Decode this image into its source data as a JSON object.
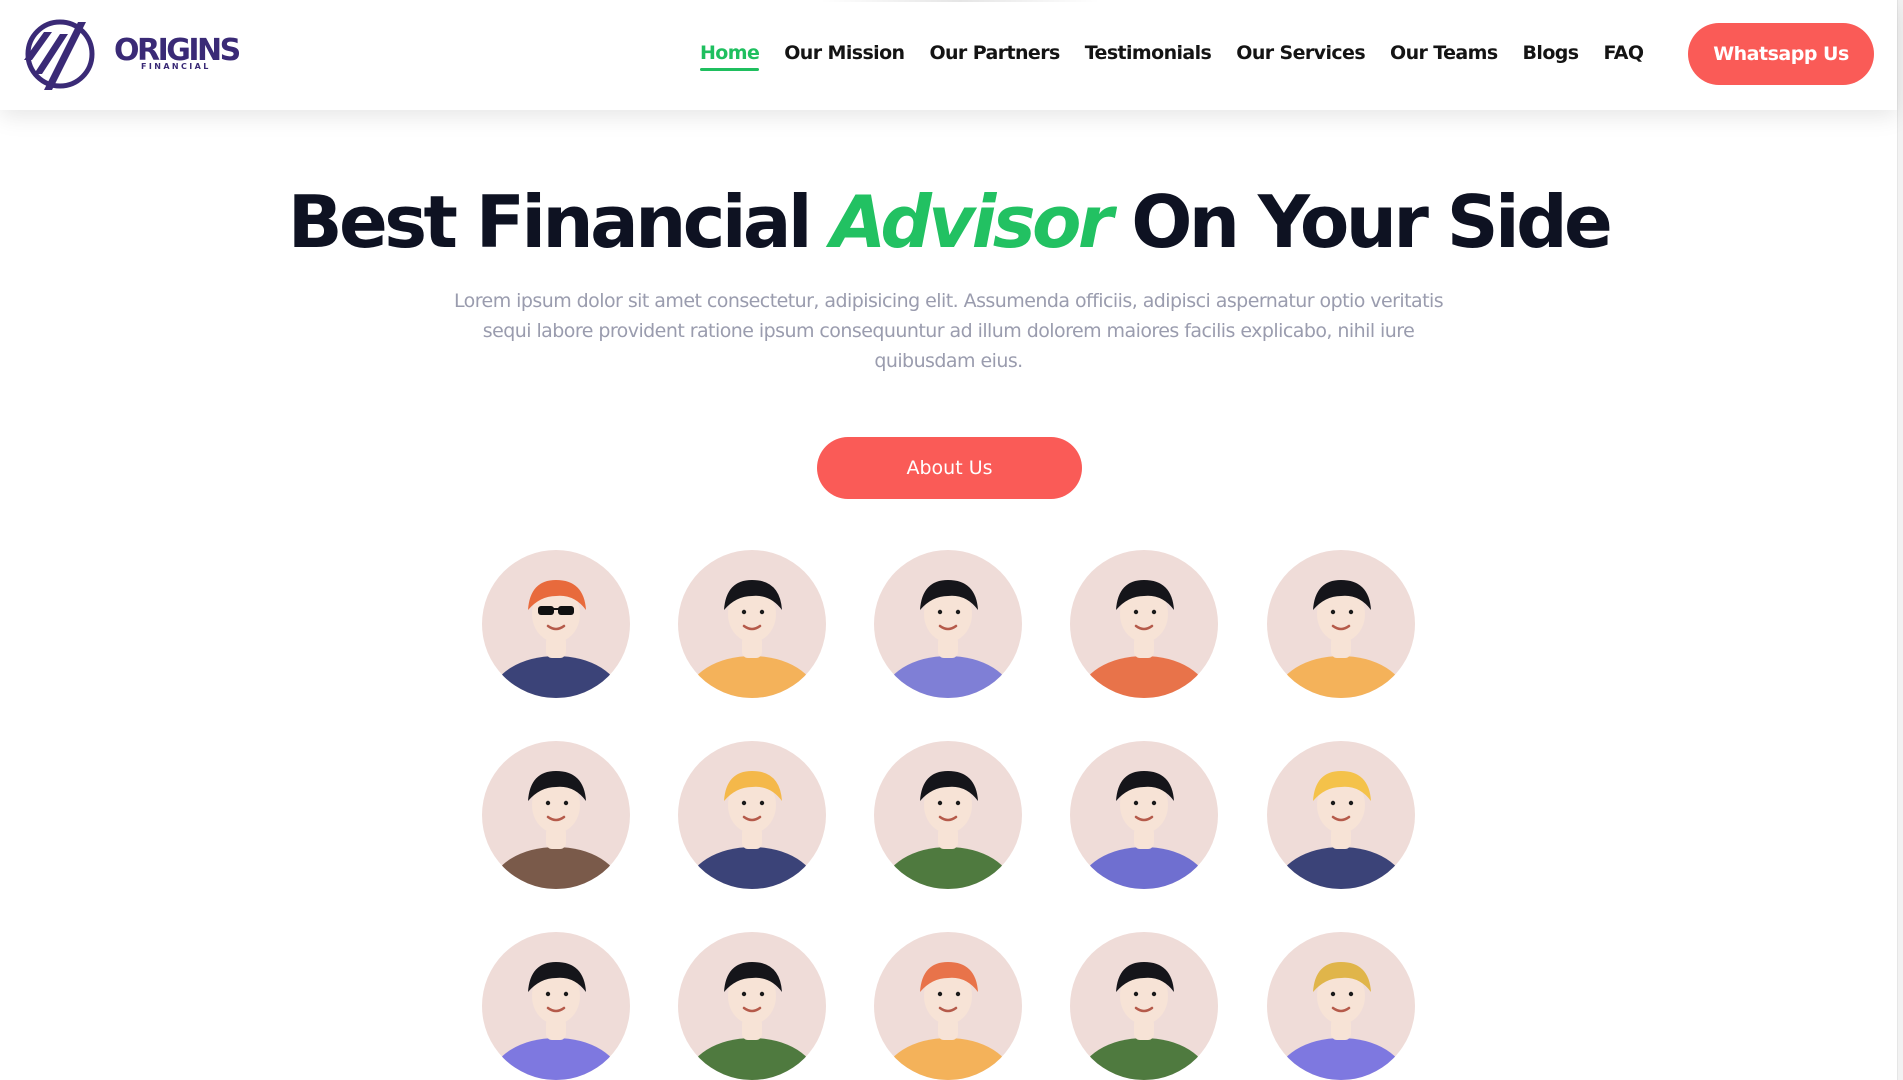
{
  "brand": {
    "name": "ORIGINS",
    "tagline": "FINANCIAL",
    "color": "#3a2a76"
  },
  "nav": {
    "links": [
      {
        "label": "Home",
        "active": true
      },
      {
        "label": "Our Mission",
        "active": false
      },
      {
        "label": "Our Partners",
        "active": false
      },
      {
        "label": "Testimonials",
        "active": false
      },
      {
        "label": "Our Services",
        "active": false
      },
      {
        "label": "Our Teams",
        "active": false
      },
      {
        "label": "Blogs",
        "active": false
      },
      {
        "label": "FAQ",
        "active": false
      }
    ],
    "cta_label": "Whatsapp Us"
  },
  "hero": {
    "title_before": "Best Financial",
    "title_accent": "Advisor",
    "title_after": "On Your Side",
    "description": "Lorem ipsum dolor sit amet consectetur, adipisicing elit. Assumenda officiis, adipisci aspernatur optio veritatis sequi labore provident ratione ipsum consequuntur ad illum dolorem maiores facilis explicabo, nihil iure quibusdam eius.",
    "button_label": "About Us"
  },
  "colors": {
    "accent_green": "#22c162",
    "cta_red": "#fa5b57",
    "heading": "#0e1222",
    "body_text": "#9a9cae",
    "avatar_bg": "#efdcd8"
  },
  "avatars": [
    {
      "hair": "#e86a3c",
      "shirt": "#3b4378",
      "sunglasses": true
    },
    {
      "hair": "#15151a",
      "shirt": "#f4b25a"
    },
    {
      "hair": "#15151a",
      "shirt": "#7f7fd6"
    },
    {
      "hair": "#15151a",
      "shirt": "#e8734a"
    },
    {
      "hair": "#15151a",
      "shirt": "#f4b25a"
    },
    {
      "hair": "#15151a",
      "shirt": "#7a5a4a"
    },
    {
      "hair": "#f4b84a",
      "shirt": "#3b4378"
    },
    {
      "hair": "#15151a",
      "shirt": "#4f7a3f"
    },
    {
      "hair": "#15151a",
      "shirt": "#6f6fd0"
    },
    {
      "hair": "#f4c24a",
      "shirt": "#3b4378"
    },
    {
      "hair": "#15151a",
      "shirt": "#7e78e0"
    },
    {
      "hair": "#15151a",
      "shirt": "#4f7a3f"
    },
    {
      "hair": "#e8734a",
      "shirt": "#f4b25a"
    },
    {
      "hair": "#15151a",
      "shirt": "#4f7a3f"
    },
    {
      "hair": "#e0b54a",
      "shirt": "#7e78e0"
    }
  ]
}
